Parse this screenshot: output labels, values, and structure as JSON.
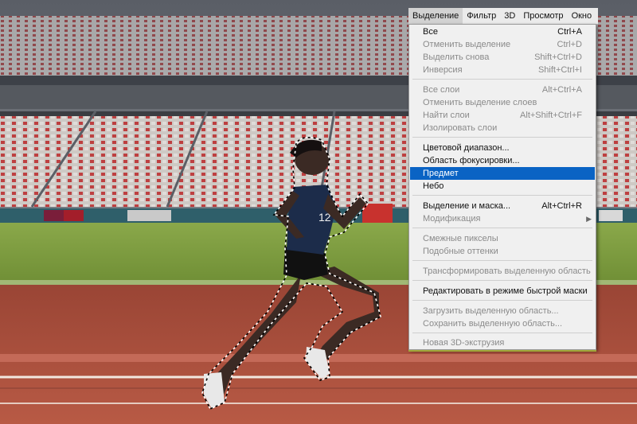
{
  "menubar": {
    "items": [
      {
        "label": "Выделение",
        "active": true
      },
      {
        "label": "Фильтр",
        "active": false
      },
      {
        "label": "3D",
        "active": false
      },
      {
        "label": "Просмотр",
        "active": false
      },
      {
        "label": "Окно",
        "active": false
      }
    ]
  },
  "menu": {
    "items": [
      {
        "label": "Все",
        "shortcut": "Ctrl+A",
        "state": "enabled"
      },
      {
        "label": "Отменить выделение",
        "shortcut": "Ctrl+D",
        "state": "disabled"
      },
      {
        "label": "Выделить снова",
        "shortcut": "Shift+Ctrl+D",
        "state": "disabled"
      },
      {
        "label": "Инверсия",
        "shortcut": "Shift+Ctrl+I",
        "state": "disabled"
      },
      {
        "label": "Все слои",
        "shortcut": "Alt+Ctrl+A",
        "state": "disabled"
      },
      {
        "label": "Отменить выделение слоев",
        "shortcut": "",
        "state": "disabled"
      },
      {
        "label": "Найти слои",
        "shortcut": "Alt+Shift+Ctrl+F",
        "state": "disabled"
      },
      {
        "label": "Изолировать слои",
        "shortcut": "",
        "state": "disabled"
      },
      {
        "label": "Цветовой диапазон...",
        "shortcut": "",
        "state": "enabled"
      },
      {
        "label": "Область фокусировки...",
        "shortcut": "",
        "state": "enabled"
      },
      {
        "label": "Предмет",
        "shortcut": "",
        "state": "highlighted"
      },
      {
        "label": "Небо",
        "shortcut": "",
        "state": "enabled"
      },
      {
        "label": "Выделение и маска...",
        "shortcut": "Alt+Ctrl+R",
        "state": "enabled"
      },
      {
        "label": "Модификация",
        "shortcut": "",
        "state": "disabled",
        "submenu": true
      },
      {
        "label": "Смежные пикселы",
        "shortcut": "",
        "state": "disabled"
      },
      {
        "label": "Подобные оттенки",
        "shortcut": "",
        "state": "disabled"
      },
      {
        "label": "Трансформировать выделенную область",
        "shortcut": "",
        "state": "disabled"
      },
      {
        "label": "Редактировать в режиме быстрой маски",
        "shortcut": "",
        "state": "enabled"
      },
      {
        "label": "Загрузить выделенную область...",
        "shortcut": "",
        "state": "disabled"
      },
      {
        "label": "Сохранить выделенную область...",
        "shortcut": "",
        "state": "disabled"
      },
      {
        "label": "Новая 3D-экструзия",
        "shortcut": "",
        "state": "disabled"
      }
    ],
    "submenu_arrow": "▶"
  },
  "photo": {
    "bib_number": "12",
    "description_icon": "runner-photo"
  },
  "colors": {
    "highlight": "#0a63c4",
    "menu_bg": "#f0f0f0",
    "track": "#b5503f",
    "grass": "#7a9a3c"
  }
}
